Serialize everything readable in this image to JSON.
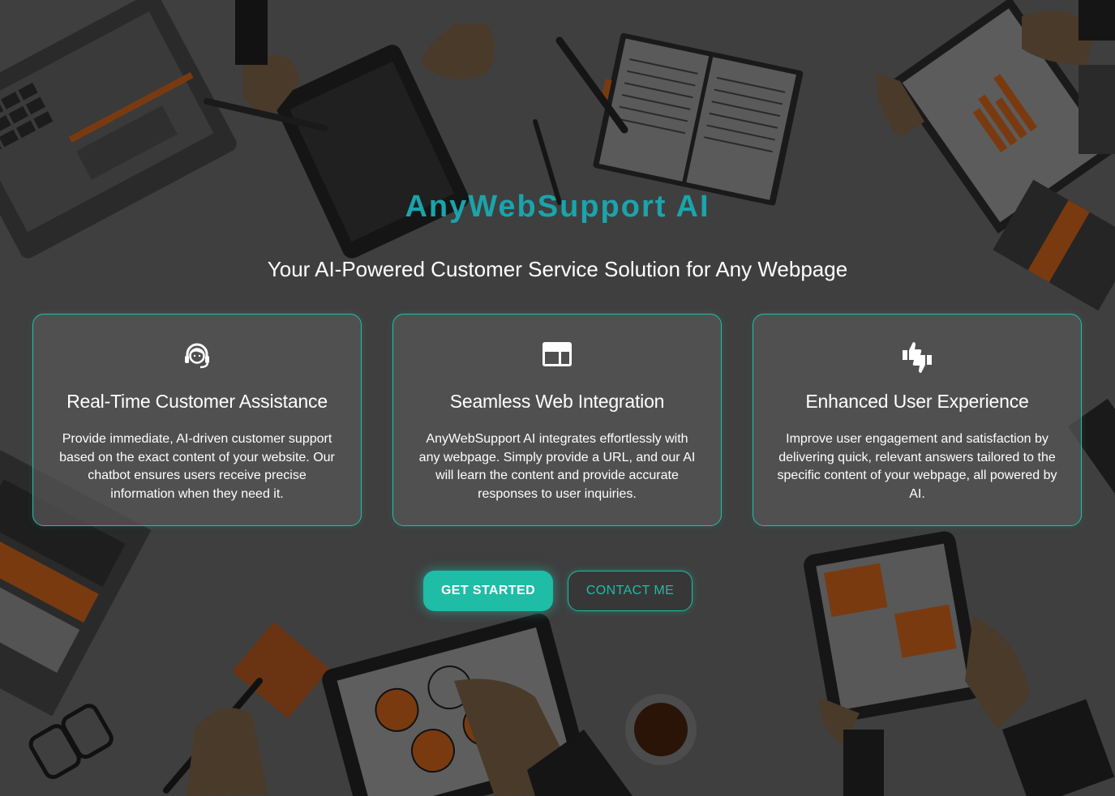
{
  "hero": {
    "brand": "AnyWebSupport AI",
    "tagline": "Your AI-Powered Customer Service Solution for Any Webpage"
  },
  "features": [
    {
      "icon": "headset-support-icon",
      "title": "Real-Time Customer Assistance",
      "description": "Provide immediate, AI-driven customer support based on the exact content of your website. Our chatbot ensures users receive precise information when they need it."
    },
    {
      "icon": "web-window-icon",
      "title": "Seamless Web Integration",
      "description": "AnyWebSupport AI integrates effortlessly with any webpage. Simply provide a URL, and our AI will learn the content and provide accurate responses to user inquiries."
    },
    {
      "icon": "thumbs-up-down-icon",
      "title": "Enhanced User Experience",
      "description": "Improve user engagement and satisfaction by delivering quick, relevant answers tailored to the specific content of your webpage, all powered by AI."
    }
  ],
  "actions": {
    "primary_label": "GET STARTED",
    "secondary_label": "CONTACT ME"
  },
  "colors": {
    "accent": "#1fbca6",
    "brand_text": "#1aa4ac",
    "background": "#404040",
    "illustration_orange": "#7a3a10"
  }
}
